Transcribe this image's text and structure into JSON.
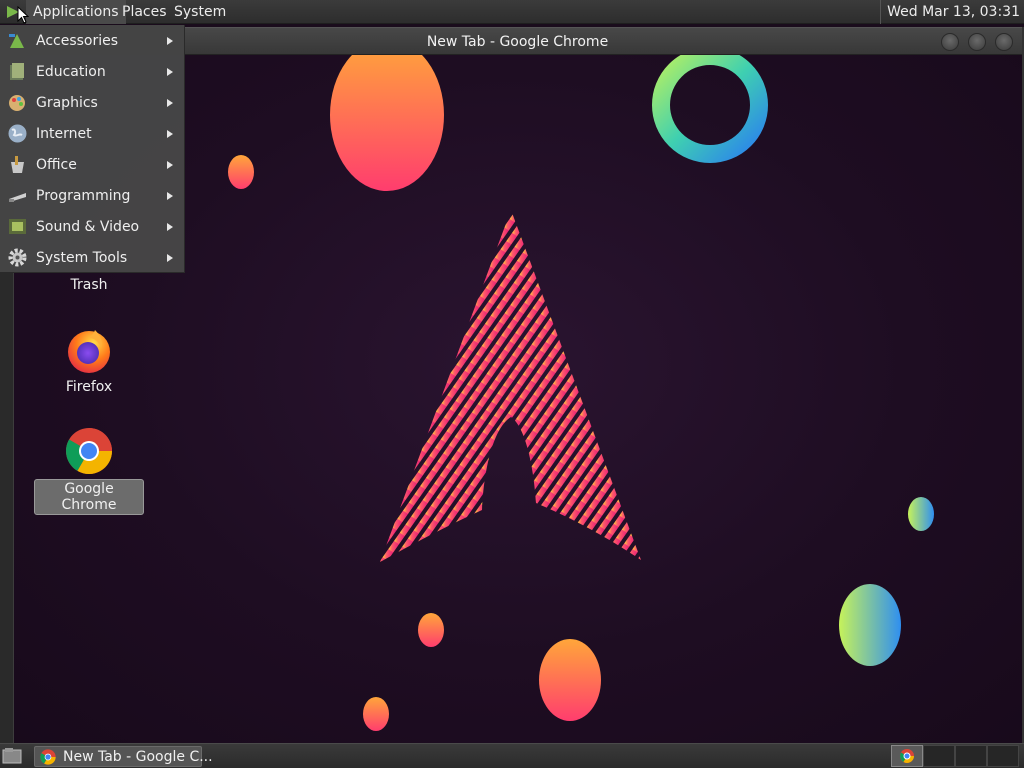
{
  "top_panel": {
    "menus": [
      "Applications",
      "Places",
      "System"
    ],
    "clock": "Wed Mar 13, 03:31"
  },
  "window": {
    "title": "New Tab - Google Chrome"
  },
  "applications_menu": {
    "items": [
      {
        "label": "Accessories",
        "icon": "accessories-icon"
      },
      {
        "label": "Education",
        "icon": "education-icon"
      },
      {
        "label": "Graphics",
        "icon": "graphics-icon"
      },
      {
        "label": "Internet",
        "icon": "internet-globe-icon"
      },
      {
        "label": "Office",
        "icon": "office-icon"
      },
      {
        "label": "Programming",
        "icon": "programming-icon"
      },
      {
        "label": "Sound & Video",
        "icon": "sound-video-icon"
      },
      {
        "label": "System Tools",
        "icon": "gear-icon"
      }
    ]
  },
  "desktop_icons": {
    "trash": "Trash",
    "firefox": "Firefox",
    "chrome": "Google Chrome"
  },
  "taskbar": {
    "chrome_task": "New Tab - Google C..."
  },
  "colors": {
    "wallpaper_bg": "#1e0d22",
    "accent_pink": "#e8206e",
    "accent_orange": "#ff9a3c"
  }
}
